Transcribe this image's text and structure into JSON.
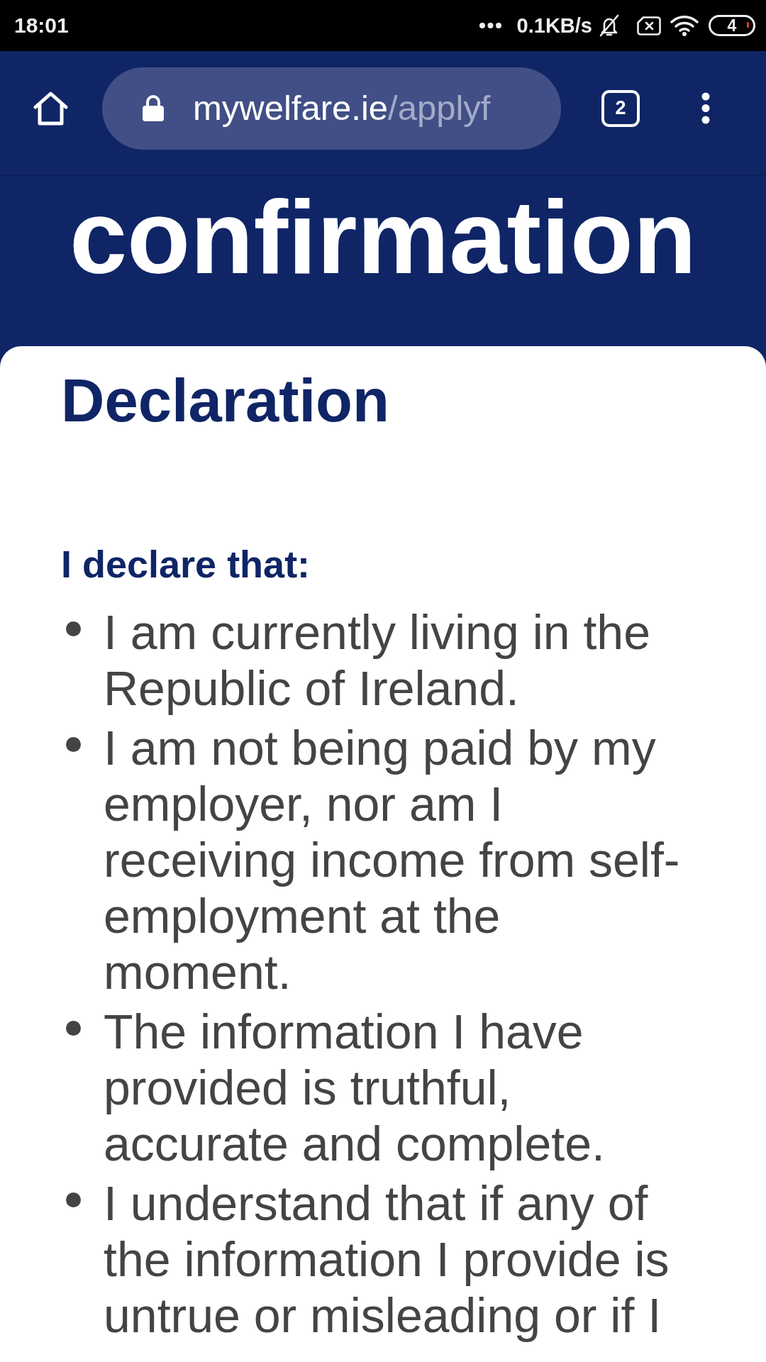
{
  "status_bar": {
    "time": "18:01",
    "network_speed": "0.1KB/s",
    "battery": "4"
  },
  "browser_toolbar": {
    "url_host": "mywelfare.ie",
    "url_path": "/applyf",
    "tab_count": "2"
  },
  "page": {
    "title": "confirmation",
    "heading": "Declaration",
    "subheading": "I declare that:",
    "declarations": [
      "I am currently living in the Republic of Ireland.",
      "I am not being paid by my employer, nor am I receiving income from self-employment at the moment.",
      "The information I have provided is truthful, accurate and complete.",
      "I understand that if any of the information I provide is untrue or misleading or if I"
    ]
  }
}
